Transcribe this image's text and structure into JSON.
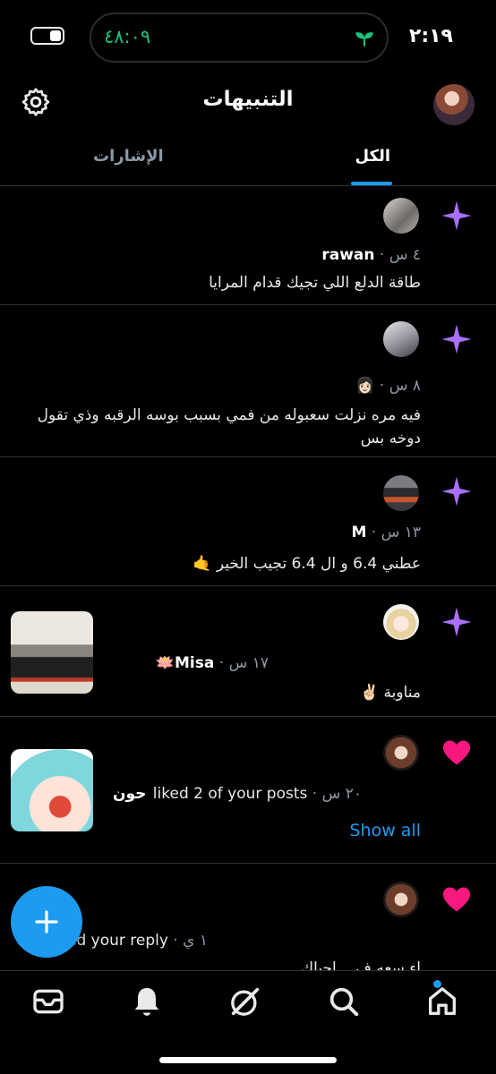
{
  "status": {
    "time": "٢:١٩",
    "activity_timer": "٤٨:٠٩"
  },
  "header": {
    "title": "التنبيهات"
  },
  "tabs": [
    {
      "label": "الكل"
    },
    {
      "label": "الإشارات"
    }
  ],
  "notifications": [
    {
      "type": "spark",
      "name": "rawan",
      "time": "٤ س",
      "text": "طاقة الدلع اللي تجيك قدام المرايا"
    },
    {
      "type": "spark",
      "name": "",
      "time": "٨ س",
      "emoji": "👩🏻",
      "text": "فيه مره نزلت سعبوله من فمي بسبب بوسه الرقبه وذي تقول دوخه بس"
    },
    {
      "type": "spark",
      "name": "M",
      "time": "١٣ س",
      "text": "عطني 6.4 و ال 6.4 تجيب الخير 🤙"
    },
    {
      "type": "spark",
      "name": "Misa🪷",
      "time": "١٧ س",
      "text": "مناوبة ✌🏻"
    },
    {
      "type": "like",
      "name": "حون",
      "action": "liked 2 of your posts",
      "time": "٢٠ س",
      "show_all": "Show all"
    },
    {
      "type": "like",
      "name": "",
      "action": "ed your reply",
      "time": "١ ي",
      "text": "اء سعه ف... إحياك"
    }
  ],
  "colors": {
    "accent": "#1d9bf0",
    "spark": "#a970ff",
    "like": "#f91880"
  }
}
